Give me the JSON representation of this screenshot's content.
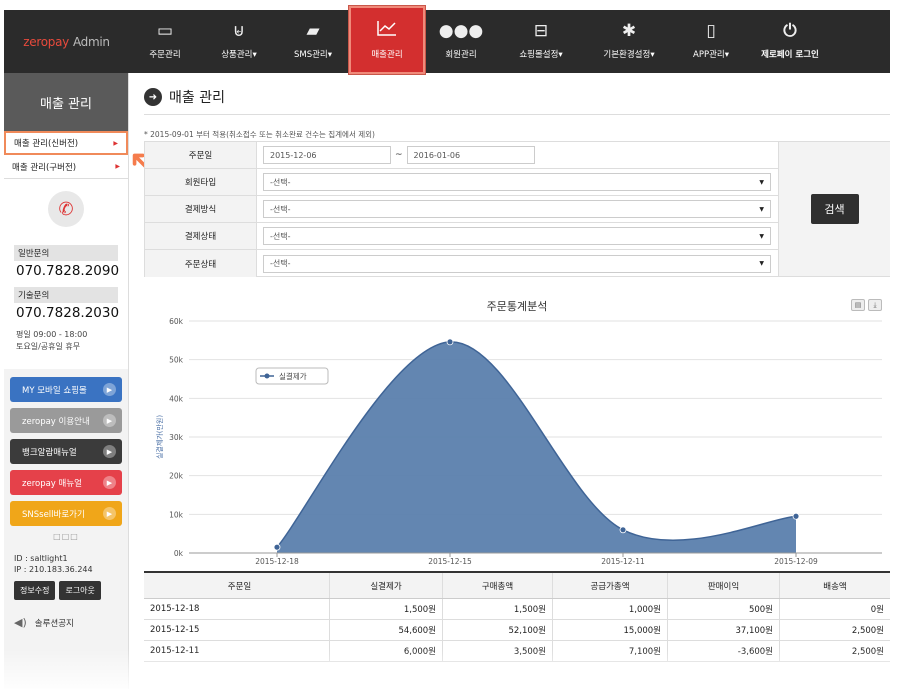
{
  "app": {
    "logo_brand": "zeropay",
    "logo_suffix": "Admin"
  },
  "nav": {
    "items": [
      {
        "label": "주문관리",
        "icon": "monitor-icon",
        "glyph": "🖵"
      },
      {
        "label": "상품관리▾",
        "icon": "basket-icon",
        "glyph": "🧺"
      },
      {
        "label": "SMS관리▾",
        "icon": "chat-icon",
        "glyph": "💬"
      },
      {
        "label": "매출관리",
        "icon": "chart-line-icon",
        "glyph": "📈"
      },
      {
        "label": "회원관리",
        "icon": "users-icon",
        "glyph": "👥"
      },
      {
        "label": "쇼핑몰설정▾",
        "icon": "cart-icon",
        "glyph": "🛒"
      },
      {
        "label": "기본환경설정▾",
        "icon": "gear-icon",
        "glyph": "⚙"
      },
      {
        "label": "APP관리▾",
        "icon": "tablet-icon",
        "glyph": "▯"
      },
      {
        "label": "제로페이 로그인",
        "icon": "power-icon",
        "glyph": "⏻"
      }
    ]
  },
  "sidebar": {
    "title": "매출 관리",
    "menu": [
      {
        "label": "매출 관리(신버전)"
      },
      {
        "label": "매출 관리(구버전)"
      }
    ],
    "contacts": [
      {
        "label": "일반문의",
        "number": "070.7828.2090"
      },
      {
        "label": "기술문의",
        "number": "070.7828.2030"
      }
    ],
    "hours_line1": "평일 09:00 - 18:00",
    "hours_line2": "토요일/공휴일 휴무",
    "quick_links": [
      {
        "label": "MY 모바일 쇼핑몰"
      },
      {
        "label": "zeropay 이용안내"
      },
      {
        "label": "뱅크알람매뉴얼"
      },
      {
        "label": "zeropay 매뉴얼"
      },
      {
        "label": "SNSsell바로가기"
      }
    ],
    "dots": "□□□",
    "user_id": "ID : saltlight1",
    "user_ip": "IP : 210.183.36.244",
    "edit_label": "정보수정",
    "logout_label": "로그아웃",
    "notice_label": "솔루션공지"
  },
  "main": {
    "title": "매출 관리",
    "notice": "* 2015-09-01 부터 적용(취소접수 또는 취소완료 건수는 집계에서 제외)",
    "filter": {
      "date_label": "주문일",
      "date_from": "2015-12-06",
      "date_sep": "~",
      "date_to": "2016-01-06",
      "member_label": "회원타입",
      "member_value": "-선택-",
      "payment_label": "결제방식",
      "payment_value": "-선택-",
      "paystatus_label": "결제상태",
      "paystatus_value": "-선택-",
      "orderstatus_label": "주문상태",
      "orderstatus_value": "-선택-",
      "search_label": "검색"
    },
    "table": {
      "headers": [
        "주문일",
        "실결제가",
        "구매총액",
        "공급가총액",
        "판매이익",
        "배송액"
      ],
      "rows": [
        [
          "2015-12-18",
          "1,500원",
          "1,500원",
          "1,000원",
          "500원",
          "0원"
        ],
        [
          "2015-12-15",
          "54,600원",
          "52,100원",
          "15,000원",
          "37,100원",
          "2,500원"
        ],
        [
          "2015-12-11",
          "6,000원",
          "3,500원",
          "7,100원",
          "-3,600원",
          "2,500원"
        ]
      ]
    }
  },
  "chart_data": {
    "type": "area",
    "title": "주문통계분석",
    "ylabel": "실결제가(만원)",
    "categories": [
      "2015-12-18",
      "2015-12-15",
      "2015-12-11",
      "2015-12-09"
    ],
    "series": [
      {
        "name": "실결제가",
        "values": [
          1500,
          54600,
          6000,
          9500
        ]
      }
    ],
    "ylim": [
      0,
      60000
    ],
    "yticks": [
      "0k",
      "10k",
      "20k",
      "30k",
      "40k",
      "50k",
      "60k"
    ],
    "grid": true,
    "legend": "top-left",
    "color": "#5b7fad"
  }
}
